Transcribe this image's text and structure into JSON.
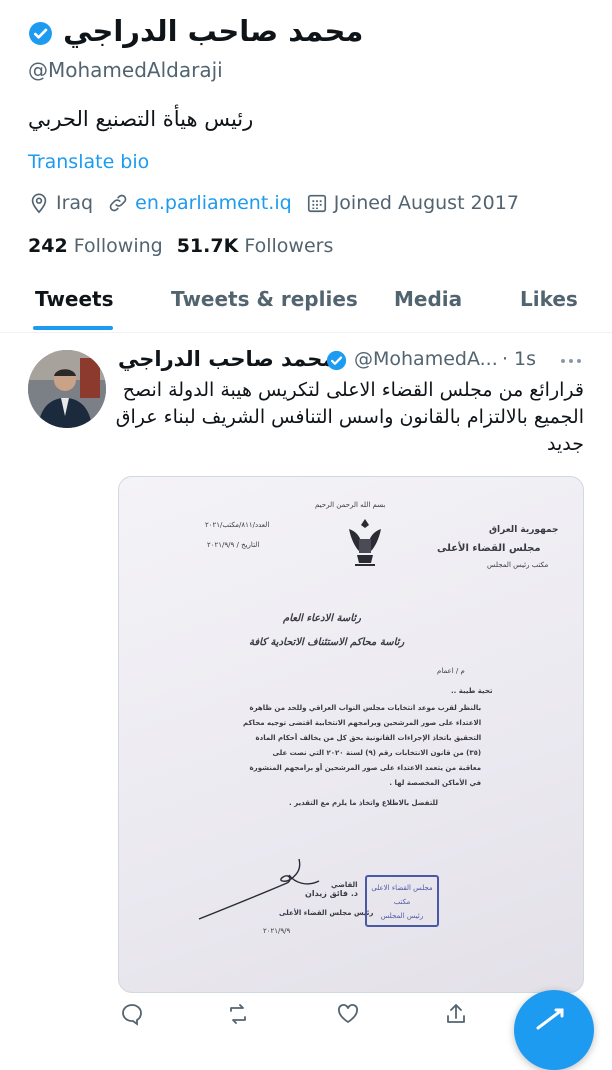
{
  "profile": {
    "display_name": "محمد صاحب الدراجي",
    "handle": "@MohamedAldaraji",
    "bio": "رئيس هيأة التصنيع الحربي",
    "translate_bio": "Translate bio",
    "location": "Iraq",
    "website": "en.parliament.iq",
    "joined": "Joined August 2017",
    "following_count": "242",
    "following_label": "Following",
    "followers_count": "51.7K",
    "followers_label": "Followers"
  },
  "tabs": [
    {
      "label": "Tweets",
      "active": true
    },
    {
      "label": "Tweets & replies",
      "active": false
    },
    {
      "label": "Media",
      "active": false
    },
    {
      "label": "Likes",
      "active": false
    }
  ],
  "tweet": {
    "author_name": "محمد صاحب الدراجي",
    "author_handle": "@MohamedA...",
    "time": "1s",
    "text": "قرارائع من مجلس القضاء الاعلى لتكريس هيبة الدولة انصح الجميع بالالتزام بالقانون واسس التنافس الشريف لبناء عراق جديد"
  },
  "document": {
    "basmala": "بسم الله الرحمن الرحيم",
    "republic": "جمهورية العراق",
    "council": "مجلس القضاء الأعلى",
    "office": "مكتب رئيس المجلس",
    "number": "العدد/٨١١/مكتب/٢٠٢١",
    "date": "التاريخ / ٢٠٢١/٩/٩",
    "to_line1": "رئاسة الادعاء العام",
    "to_line2": "رئاسة محاكم الاستئناف الاتحادية كافة",
    "subject": "م / اعمام",
    "greeting": "تحية طيبة ..",
    "body": [
      "بالنظر لقرب موعد انتخابات مجلس النواب العراقي وللحد من ظاهرة",
      "الاعتداء على صور المرشحين وبرامجهم الانتخابية اقتضى توجيه محاكم",
      "التحقيق باتخاذ الإجراءات القانونية بحق كل من يخالف أحكام المادة",
      "(٣٥) من قانون الانتخابات رقم (٩) لسنة ٢٠٢٠ التي نصت على",
      "معاقبة من يتعمد الاعتداء على صور المرشحين أو برامجهم المنشورة",
      "في الأماكن المخصصة لها ."
    ],
    "closing": "للتفضل بالاطلاع واتخاذ ما يلزم مع التقدير .",
    "judge_title": "القاضي",
    "judge_name": "د. فائق زيدان",
    "judge_role": "رئيس مجلس القضاء الأعلى",
    "sign_date": "٢٠٢١/٩/٩",
    "stamp_line1": "مجلس القضاء الاعلى",
    "stamp_line2": "مكتب",
    "stamp_line3": "رئيس المجلس"
  },
  "icons": {
    "verified": "verified-badge-icon",
    "location": "location-pin-icon",
    "link": "link-icon",
    "calendar": "calendar-icon",
    "more": "more-options-icon",
    "reply": "reply-icon",
    "retweet": "retweet-icon",
    "like": "heart-icon",
    "share": "share-icon",
    "compose": "compose-tweet-icon"
  },
  "colors": {
    "accent": "#1d9bf0",
    "text": "#0f1419",
    "secondary": "#536471"
  }
}
